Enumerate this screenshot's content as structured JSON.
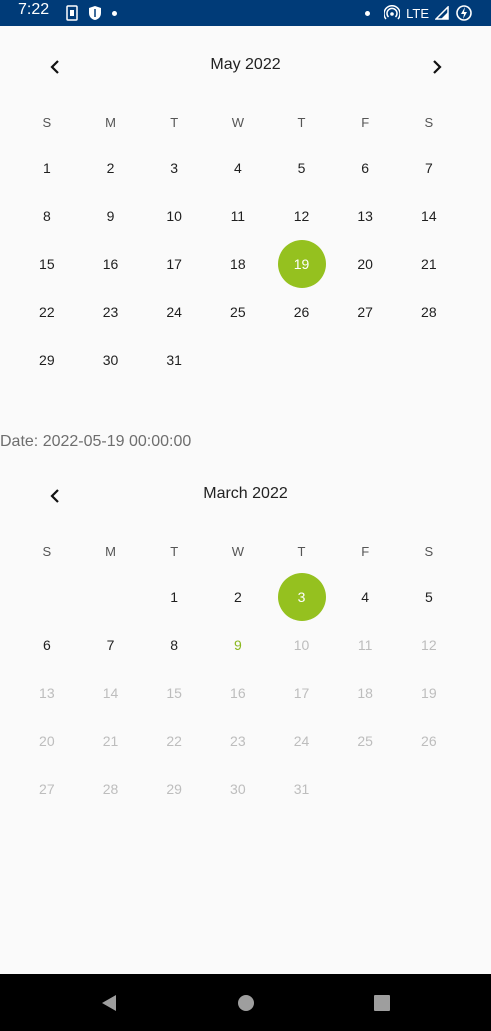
{
  "status_bar": {
    "time": "7:22",
    "network": "LTE",
    "left_icons": [
      "sim-icon",
      "shield-icon",
      "dot-icon"
    ],
    "right_icons": [
      "dot-icon",
      "hotspot-icon",
      "signal-icon",
      "battery-charging-icon"
    ]
  },
  "colors": {
    "status_bar": "#003b78",
    "accent": "#95c11f",
    "today_text": "#8bb81f",
    "disabled_text": "#bdbdbd"
  },
  "calendar1": {
    "title": "May 2022",
    "weekdays": [
      "S",
      "M",
      "T",
      "W",
      "T",
      "F",
      "S"
    ],
    "first_weekday_index": 0,
    "days": [
      "1",
      "2",
      "3",
      "4",
      "5",
      "6",
      "7",
      "8",
      "9",
      "10",
      "11",
      "12",
      "13",
      "14",
      "15",
      "16",
      "17",
      "18",
      "19",
      "20",
      "21",
      "22",
      "23",
      "24",
      "25",
      "26",
      "27",
      "28",
      "29",
      "30",
      "31"
    ],
    "selected_day": "19",
    "today_day": null,
    "max_enabled_day": 31,
    "has_prev": true,
    "has_next": true
  },
  "date_text": "Date: 2022-05-19 00:00:00",
  "calendar2": {
    "title": "March 2022",
    "weekdays": [
      "S",
      "M",
      "T",
      "W",
      "T",
      "F",
      "S"
    ],
    "first_weekday_index": 2,
    "days": [
      "1",
      "2",
      "3",
      "4",
      "5",
      "6",
      "7",
      "8",
      "9",
      "10",
      "11",
      "12",
      "13",
      "14",
      "15",
      "16",
      "17",
      "18",
      "19",
      "20",
      "21",
      "22",
      "23",
      "24",
      "25",
      "26",
      "27",
      "28",
      "29",
      "30",
      "31"
    ],
    "selected_day": "3",
    "today_day": "9",
    "max_enabled_day": 9,
    "has_prev": true,
    "has_next": false
  }
}
